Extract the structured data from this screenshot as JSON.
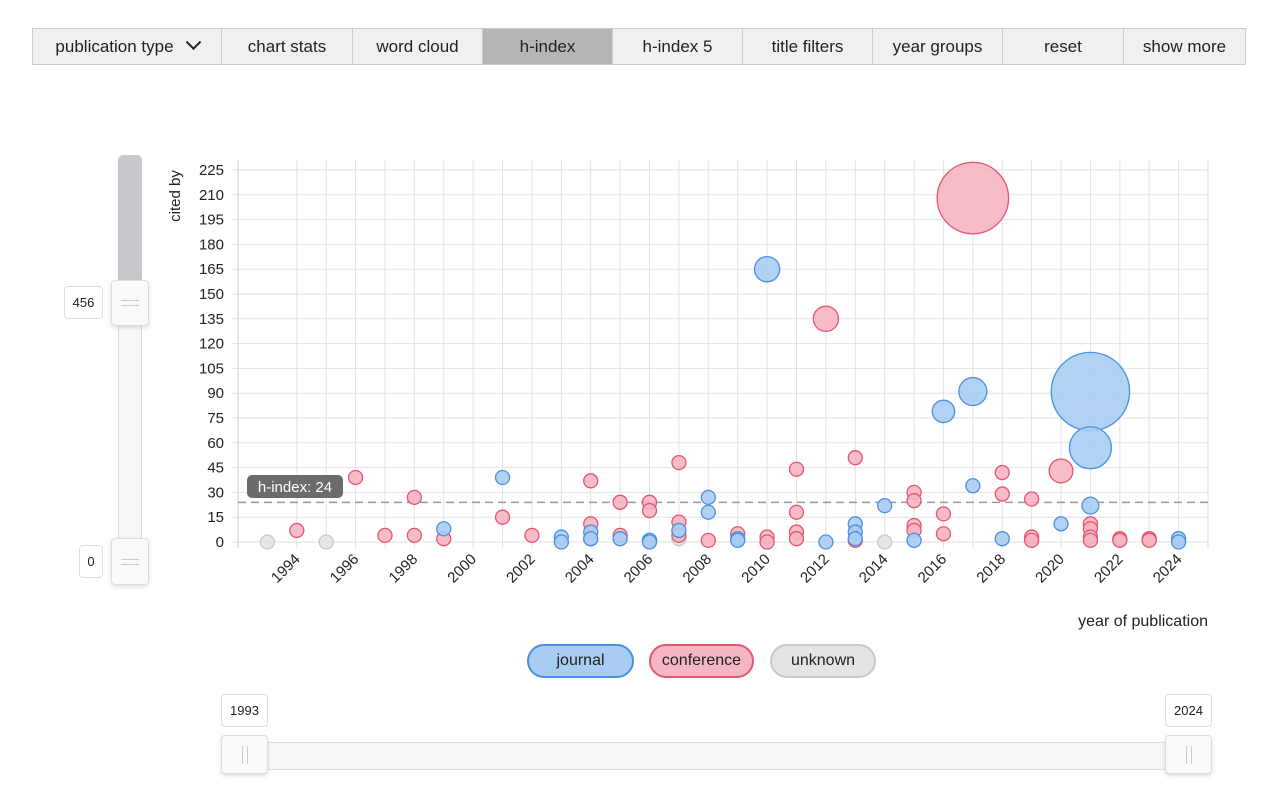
{
  "toolbar": {
    "items": [
      {
        "label": "publication type",
        "has_dropdown": true
      },
      {
        "label": "chart stats"
      },
      {
        "label": "word cloud"
      },
      {
        "label": "h-index",
        "active": true
      },
      {
        "label": "h-index 5"
      },
      {
        "label": "title filters"
      },
      {
        "label": "year groups"
      },
      {
        "label": "reset"
      },
      {
        "label": "show more"
      }
    ]
  },
  "citation_slider": {
    "max_label": "456",
    "min_label": "0"
  },
  "year_slider": {
    "min_label": "1993",
    "max_label": "2024"
  },
  "legend": {
    "journal": "journal",
    "conference": "conference",
    "unknown": "unknown"
  },
  "colors": {
    "journal": {
      "fill": "#a9cdf2",
      "stroke": "#4a90e2"
    },
    "conference": {
      "fill": "#f5b5c2",
      "stroke": "#e8556f"
    },
    "unknown": {
      "fill": "#e3e3e3",
      "stroke": "#c8c8c8"
    },
    "active_button": "#b5b5b5"
  },
  "chart_data": {
    "type": "scatter",
    "xlabel": "year of publication",
    "ylabel": "cited by",
    "xlim": [
      1992,
      2025
    ],
    "ylim": [
      0,
      225
    ],
    "xticks": [
      "1994",
      "1996",
      "1998",
      "2000",
      "2002",
      "2004",
      "2006",
      "2008",
      "2010",
      "2012",
      "2014",
      "2016",
      "2018",
      "2020",
      "2022",
      "2024"
    ],
    "yticks": [
      "0",
      "15",
      "30",
      "45",
      "60",
      "75",
      "90",
      "105",
      "120",
      "135",
      "150",
      "165",
      "180",
      "195",
      "210",
      "225"
    ],
    "grid": true,
    "h_index": {
      "value": 24,
      "label": "h-index: 24"
    },
    "series": [
      {
        "name": "unknown",
        "points": [
          [
            1993,
            0,
            1
          ],
          [
            1995,
            0,
            1
          ],
          [
            2007,
            2,
            1
          ],
          [
            2014,
            0,
            1
          ]
        ]
      },
      {
        "name": "conference",
        "points": [
          [
            1994,
            7,
            1
          ],
          [
            1996,
            39,
            1
          ],
          [
            1997,
            4,
            1
          ],
          [
            1998,
            27,
            1
          ],
          [
            1998,
            4,
            1
          ],
          [
            1999,
            2,
            1
          ],
          [
            2001,
            15,
            1
          ],
          [
            2002,
            4,
            1
          ],
          [
            2004,
            37,
            1
          ],
          [
            2004,
            11,
            1
          ],
          [
            2004,
            2,
            1
          ],
          [
            2005,
            24,
            1
          ],
          [
            2005,
            4,
            1
          ],
          [
            2006,
            24,
            1
          ],
          [
            2006,
            19,
            1
          ],
          [
            2006,
            1,
            1
          ],
          [
            2007,
            48,
            1
          ],
          [
            2007,
            12,
            1
          ],
          [
            2007,
            4,
            1
          ],
          [
            2008,
            1,
            1
          ],
          [
            2009,
            5,
            1
          ],
          [
            2010,
            3,
            1
          ],
          [
            2010,
            0,
            1
          ],
          [
            2011,
            44,
            1
          ],
          [
            2011,
            18,
            1
          ],
          [
            2011,
            6,
            1
          ],
          [
            2011,
            2,
            1
          ],
          [
            2012,
            135,
            1.8
          ],
          [
            2013,
            51,
            1
          ],
          [
            2013,
            1,
            1
          ],
          [
            2015,
            30,
            1
          ],
          [
            2015,
            25,
            1
          ],
          [
            2015,
            10,
            1
          ],
          [
            2015,
            7,
            1
          ],
          [
            2016,
            17,
            1
          ],
          [
            2016,
            5,
            1
          ],
          [
            2017,
            208,
            5.1
          ],
          [
            2018,
            42,
            1
          ],
          [
            2018,
            29,
            1
          ],
          [
            2019,
            26,
            1
          ],
          [
            2019,
            3,
            1
          ],
          [
            2019,
            1,
            1
          ],
          [
            2020,
            43,
            1.7
          ],
          [
            2021,
            11,
            1
          ],
          [
            2021,
            8,
            1
          ],
          [
            2021,
            3,
            1
          ],
          [
            2021,
            1,
            1
          ],
          [
            2022,
            2,
            1
          ],
          [
            2022,
            1,
            1
          ],
          [
            2023,
            2,
            1
          ],
          [
            2023,
            1,
            1
          ]
        ]
      },
      {
        "name": "journal",
        "points": [
          [
            1999,
            8,
            1
          ],
          [
            2001,
            39,
            1
          ],
          [
            2003,
            3,
            1
          ],
          [
            2003,
            0,
            1
          ],
          [
            2004,
            6,
            1
          ],
          [
            2004,
            2,
            1
          ],
          [
            2005,
            2,
            1
          ],
          [
            2006,
            1,
            1
          ],
          [
            2006,
            0,
            1
          ],
          [
            2007,
            7,
            1
          ],
          [
            2008,
            27,
            1
          ],
          [
            2008,
            18,
            1
          ],
          [
            2009,
            2,
            1
          ],
          [
            2009,
            1,
            1
          ],
          [
            2010,
            165,
            1.8
          ],
          [
            2012,
            0,
            1
          ],
          [
            2013,
            11,
            1
          ],
          [
            2013,
            6,
            1
          ],
          [
            2013,
            2,
            1
          ],
          [
            2014,
            22,
            1
          ],
          [
            2015,
            1,
            1
          ],
          [
            2016,
            79,
            1.6
          ],
          [
            2017,
            91,
            2
          ],
          [
            2017,
            34,
            1
          ],
          [
            2018,
            2,
            1
          ],
          [
            2020,
            11,
            1
          ],
          [
            2021,
            91,
            5.6
          ],
          [
            2021,
            57,
            3
          ],
          [
            2021,
            22,
            1.2
          ],
          [
            2024,
            2,
            1
          ],
          [
            2024,
            0,
            1
          ]
        ]
      }
    ]
  }
}
